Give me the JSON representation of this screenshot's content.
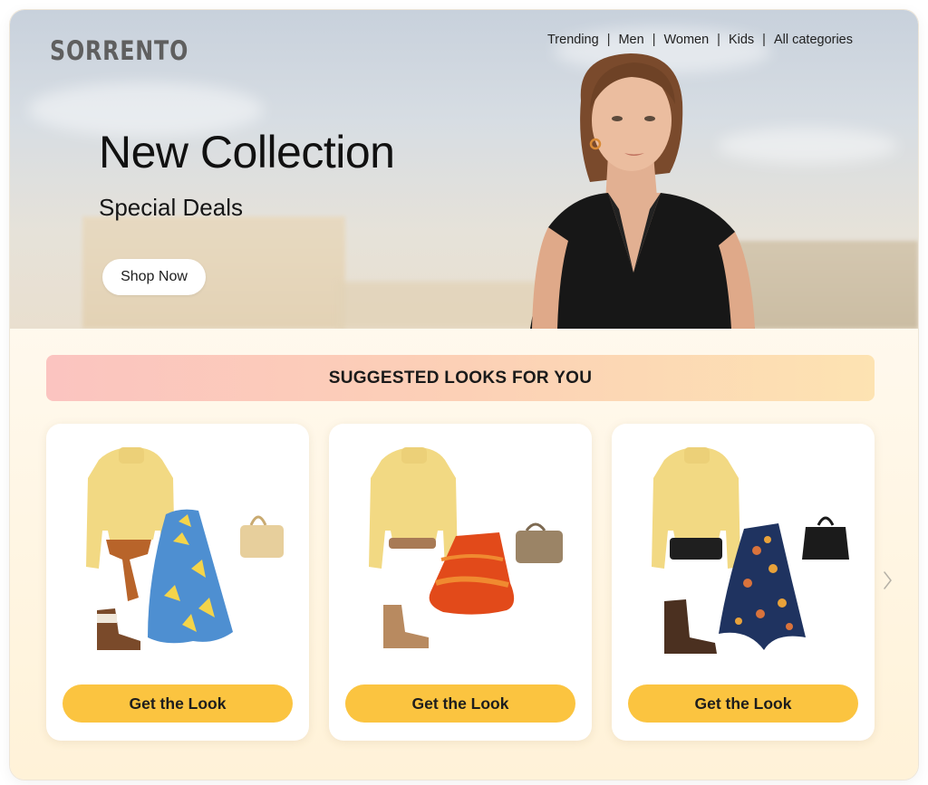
{
  "brand": {
    "logo": "SORRENTO"
  },
  "nav": {
    "items": [
      "Trending",
      "Men",
      "Women",
      "Kids",
      "All categories"
    ],
    "separator": "|"
  },
  "hero": {
    "title": "New Collection",
    "subtitle": "Special Deals",
    "cta_label": "Shop Now"
  },
  "suggested": {
    "heading": "SUGGESTED LOOKS FOR YOU",
    "cards": [
      {
        "button_label": "Get the Look",
        "skirt_color": "#4e8fd1",
        "bag_color": "#e7cf9c",
        "boot_color": "#7a4a2a"
      },
      {
        "button_label": "Get the Look",
        "skirt_color": "#e24a1a",
        "bag_color": "#9b8466",
        "boot_color": "#b88a60"
      },
      {
        "button_label": "Get the Look",
        "skirt_color": "#1f3360",
        "bag_color": "#1b1b1b",
        "boot_color": "#4b3020"
      }
    ],
    "next_icon": "chevron-right-icon"
  },
  "colors": {
    "accent": "#fbc440",
    "banner_start": "#fbc4c0",
    "banner_end": "#fde3b2"
  }
}
